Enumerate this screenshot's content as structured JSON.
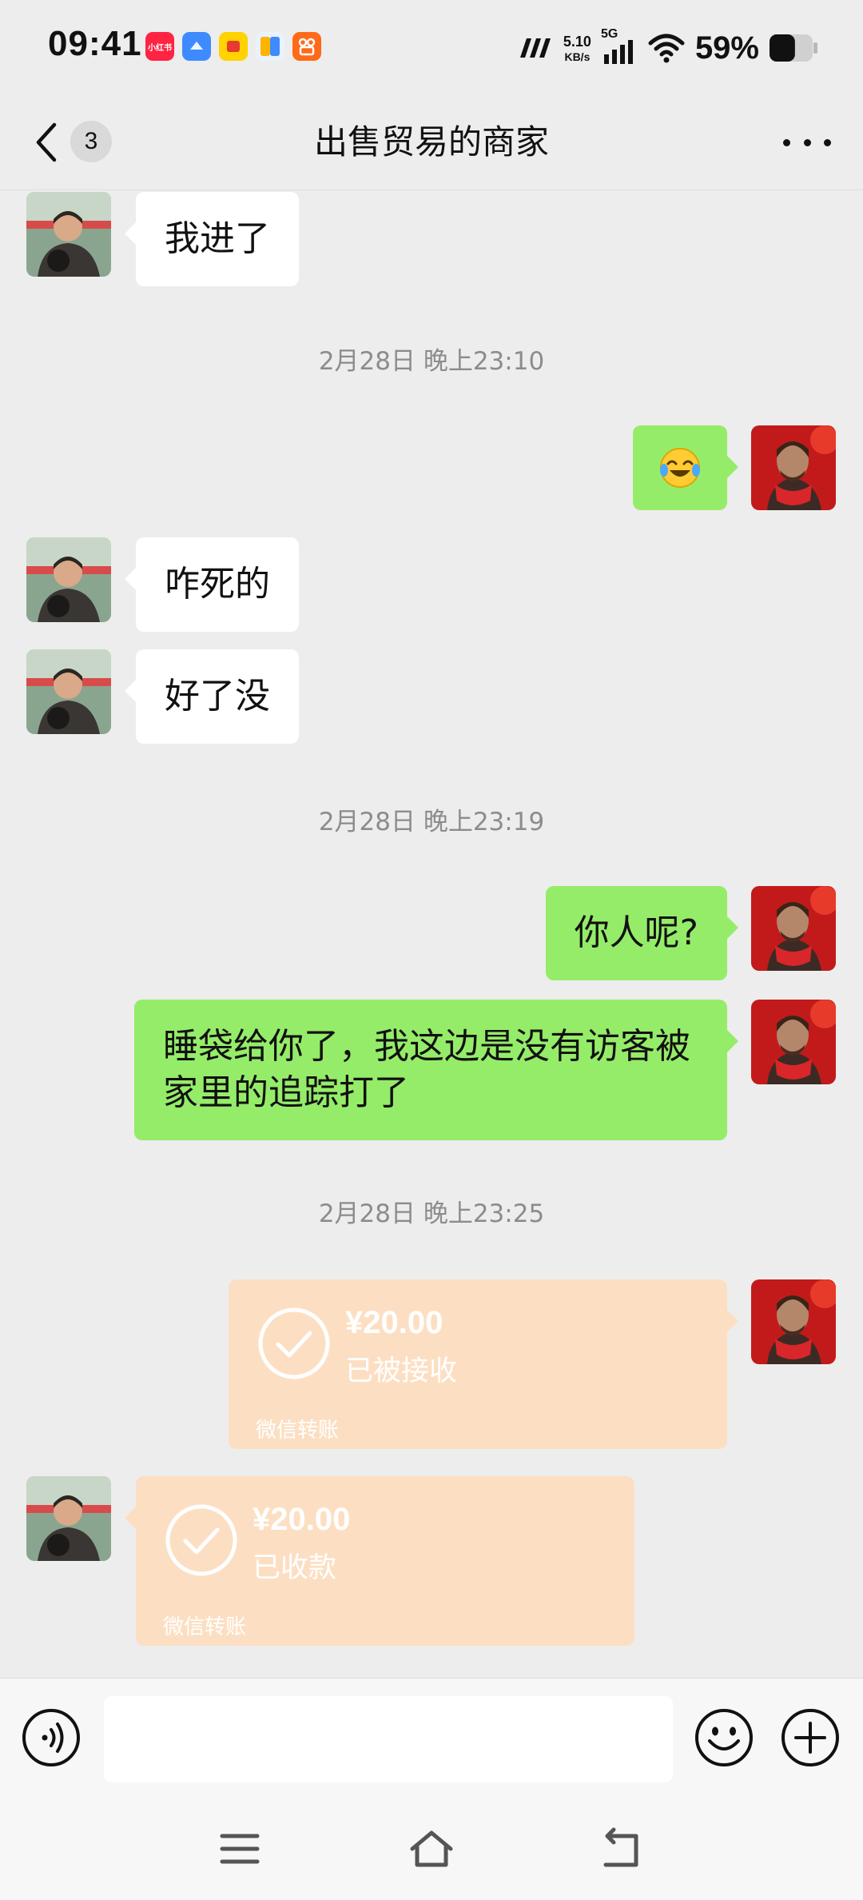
{
  "status_bar": {
    "time": "09:41",
    "app_icons": [
      {
        "name": "xiaohongshu-icon",
        "text": "小红书",
        "color": "#ff2442"
      },
      {
        "name": "cloud-app-icon",
        "text": "",
        "color": "#3d8bff"
      },
      {
        "name": "yellow-app-icon",
        "text": "",
        "color": "#ffd200"
      },
      {
        "name": "files-app-icon",
        "text": "",
        "color": "#5fb0ff"
      },
      {
        "name": "kuaishou-icon",
        "text": "",
        "color": "#ff6a1a"
      }
    ],
    "net_speed_value": "5.10",
    "net_speed_unit": "KB/s",
    "network_type": "5G",
    "battery_percent": "59%",
    "battery_level": 0.59
  },
  "nav": {
    "unread_count": "3",
    "title": "出售贸易的商家"
  },
  "messages": [
    {
      "side": "left",
      "text": "我进了"
    },
    {
      "timestamp": "2月28日 晚上23:10"
    },
    {
      "side": "right",
      "emoji": "😭"
    },
    {
      "side": "left",
      "text": "咋死的"
    },
    {
      "side": "left",
      "text": "好了没"
    },
    {
      "timestamp": "2月28日 晚上23:19"
    },
    {
      "side": "right",
      "text": "你人呢?"
    },
    {
      "side": "right",
      "text": "睡袋给你了，我这边是没有访客被家里的追踪打了"
    },
    {
      "timestamp": "2月28日 晚上23:25"
    },
    {
      "side": "right",
      "type": "transfer",
      "amount": "¥20.00",
      "status": "已被接收",
      "label": "微信转账"
    },
    {
      "side": "left",
      "type": "transfer",
      "amount": "¥20.00",
      "status": "已收款",
      "label": "微信转账"
    }
  ],
  "input": {
    "placeholder": ""
  },
  "colors": {
    "background": "#ededed",
    "my_bubble": "#95ec69",
    "their_bubble": "#ffffff",
    "transfer_accepted": "#fcdfc3",
    "timestamp": "#8c8c8c"
  }
}
